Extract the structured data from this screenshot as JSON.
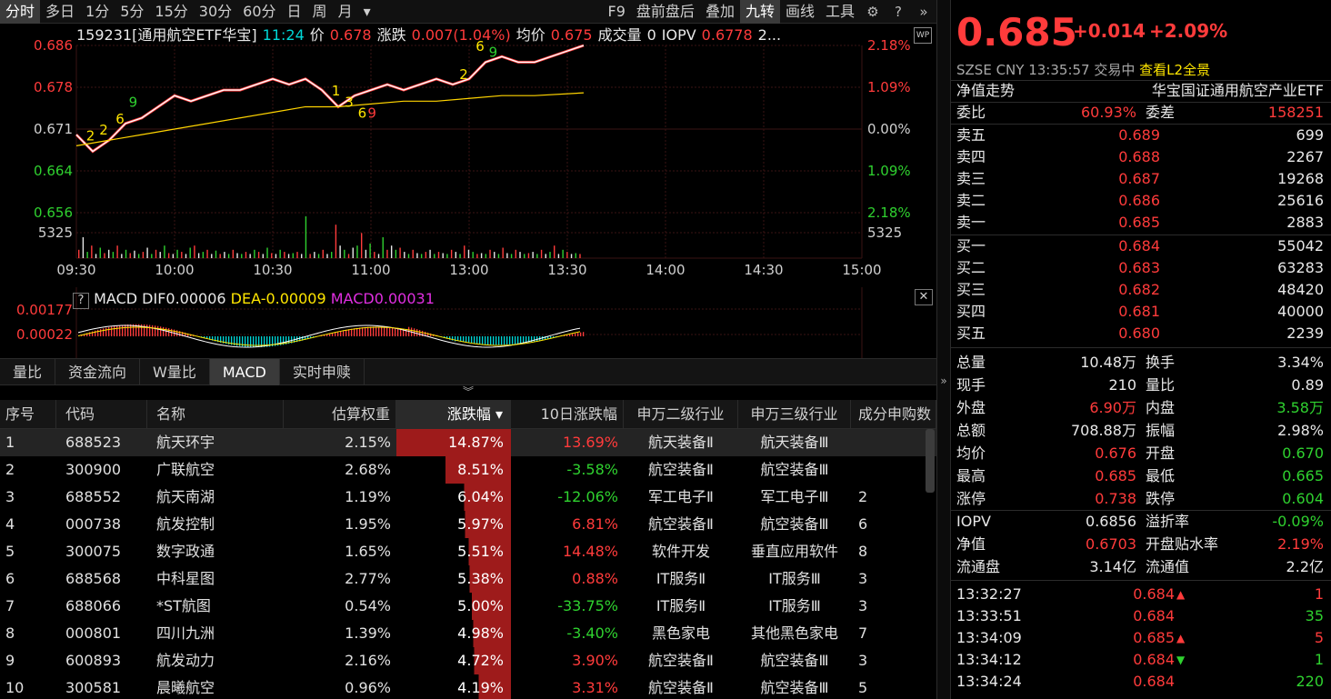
{
  "toolbar": {
    "tabs": [
      "分时",
      "多日",
      "1分",
      "5分",
      "15分",
      "30分",
      "60分",
      "日",
      "周",
      "月"
    ],
    "dropdown_glyph": "▾",
    "right_items": [
      "F9",
      "盘前盘后",
      "叠加",
      "九转",
      "画线",
      "工具"
    ],
    "active_tab": "分时",
    "active_right": "九转"
  },
  "info": {
    "code_name": "159231[通用航空ETF华宝]",
    "time": "11:24",
    "price_label": "价",
    "price": "0.678",
    "change_label": "涨跌",
    "change": "0.007(1.04%)",
    "avg_label": "均价",
    "avg": "0.675",
    "vol_label": "成交量",
    "vol": "0",
    "iopv_label": "IOPV",
    "iopv": "0.6778",
    "more": "2..."
  },
  "chart_data": {
    "type": "line",
    "y_left_ticks": [
      "0.686",
      "0.678",
      "0.671",
      "0.664",
      "0.656"
    ],
    "y_right_ticks": [
      "2.18%",
      "1.09%",
      "0.00%",
      "1.09%",
      "2.18%"
    ],
    "volume_label": "5325",
    "x_ticks": [
      "09:30",
      "10:00",
      "10:30",
      "11:00",
      "13:00",
      "13:30",
      "14:00",
      "14:30",
      "15:00"
    ],
    "ylim": [
      0.656,
      0.686
    ],
    "series": [
      {
        "name": "价",
        "color": "#ffffff",
        "x": [
          0,
          5,
          10,
          15,
          20,
          25,
          30,
          35,
          40,
          45,
          50,
          55,
          60,
          65,
          70,
          75,
          80,
          85,
          90,
          95,
          100,
          105,
          110,
          115,
          120,
          125,
          130,
          135,
          140,
          145,
          150,
          155
        ],
        "values": [
          0.67,
          0.667,
          0.669,
          0.672,
          0.673,
          0.675,
          0.677,
          0.676,
          0.677,
          0.678,
          0.678,
          0.679,
          0.68,
          0.679,
          0.68,
          0.678,
          0.675,
          0.677,
          0.678,
          0.679,
          0.678,
          0.679,
          0.68,
          0.679,
          0.68,
          0.683,
          0.684,
          0.683,
          0.683,
          0.684,
          0.685,
          0.686
        ]
      },
      {
        "name": "均价",
        "color": "#ffd400",
        "x": [
          0,
          10,
          20,
          30,
          40,
          50,
          60,
          70,
          80,
          90,
          100,
          110,
          120,
          130,
          140,
          155
        ],
        "values": [
          0.668,
          0.669,
          0.67,
          0.671,
          0.672,
          0.673,
          0.674,
          0.675,
          0.675,
          0.6755,
          0.676,
          0.676,
          0.6765,
          0.677,
          0.677,
          0.6775
        ]
      }
    ],
    "annotations": [
      {
        "x": 3,
        "y": 0.669,
        "text": "2",
        "color": "#ffe600"
      },
      {
        "x": 7,
        "y": 0.67,
        "text": "2",
        "color": "#ffe600"
      },
      {
        "x": 12,
        "y": 0.672,
        "text": "6",
        "color": "#ffe600"
      },
      {
        "x": 16,
        "y": 0.675,
        "text": "9",
        "color": "#2fd12f"
      },
      {
        "x": 78,
        "y": 0.677,
        "text": "1",
        "color": "#ffe600"
      },
      {
        "x": 82,
        "y": 0.675,
        "text": "3",
        "color": "#ffe600"
      },
      {
        "x": 86,
        "y": 0.673,
        "text": "6",
        "color": "#ffe600"
      },
      {
        "x": 89,
        "y": 0.673,
        "text": "9",
        "color": "#ff3b3b"
      },
      {
        "x": 117,
        "y": 0.68,
        "text": "2",
        "color": "#ffe600"
      },
      {
        "x": 122,
        "y": 0.685,
        "text": "6",
        "color": "#ffe600"
      },
      {
        "x": 126,
        "y": 0.684,
        "text": "9",
        "color": "#2fd12f"
      }
    ],
    "volume": [
      0.2,
      0.5,
      0.15,
      0.3,
      0.1,
      0.25,
      0.12,
      0.2,
      0.15,
      0.3,
      0.1,
      0.2,
      0.12,
      0.18,
      0.1,
      0.15,
      0.25,
      0.1,
      0.2,
      0.15,
      0.3,
      0.12,
      0.1,
      0.2,
      0.15,
      0.1,
      0.25,
      0.3,
      0.12,
      0.15,
      0.2,
      0.1,
      0.18,
      0.1,
      0.15,
      0.1,
      0.2,
      0.12,
      0.1,
      0.15,
      0.1,
      0.2,
      0.15,
      0.1,
      0.25,
      0.12,
      0.1,
      0.2,
      0.15,
      0.1,
      0.12,
      0.15,
      0.1,
      1.0,
      0.1,
      0.15,
      0.1,
      0.2,
      0.1,
      0.15,
      0.8,
      0.3,
      0.2,
      0.1,
      0.25,
      0.3,
      0.6,
      0.2,
      0.35,
      0.15,
      0.1,
      0.5,
      0.2,
      0.3,
      0.2,
      0.25,
      0.15,
      0.1,
      0.2,
      0.12,
      0.1,
      0.15,
      0.2,
      0.1,
      0.15,
      0.12,
      0.1,
      0.2,
      0.15,
      0.1,
      0.3,
      0.2,
      0.15,
      0.1,
      0.12,
      0.1,
      0.2,
      0.15,
      0.1,
      0.25,
      0.12,
      0.1,
      0.2,
      0.15,
      0.1,
      0.12,
      0.15,
      0.1,
      0.2,
      0.1,
      0.15,
      0.3,
      0.1,
      0.2,
      0.15,
      0.1,
      0.12,
      0.1
    ]
  },
  "macd": {
    "help": "?",
    "label": "MACD",
    "dif_label": "DIF",
    "dif": "0.00006",
    "dea_label": "DEA",
    "dea": "-0.00009",
    "macd_label": "MACD",
    "macd": "0.00031",
    "y_ticks": [
      "0.00177",
      "0.00022"
    ]
  },
  "lower_tabs": [
    "量比",
    "资金流向",
    "W量比",
    "MACD",
    "实时申赎"
  ],
  "lower_active": "MACD",
  "collapse_glyph": "︾",
  "table": {
    "headers": [
      "序号",
      "代码",
      "名称",
      "估算权重",
      "涨跌幅 ▾",
      "10日涨跌幅",
      "申万二级行业",
      "申万三级行业",
      "成分申购数"
    ],
    "rows": [
      [
        "1",
        "688523",
        "航天环宇",
        "2.15%",
        "14.87%",
        "13.69%",
        "航天装备Ⅱ",
        "航天装备Ⅲ",
        ""
      ],
      [
        "2",
        "300900",
        "广联航空",
        "2.68%",
        "8.51%",
        "-3.58%",
        "航空装备Ⅱ",
        "航空装备Ⅲ",
        ""
      ],
      [
        "3",
        "688552",
        "航天南湖",
        "1.19%",
        "6.04%",
        "-12.06%",
        "军工电子Ⅱ",
        "军工电子Ⅲ",
        "2"
      ],
      [
        "4",
        "000738",
        "航发控制",
        "1.95%",
        "5.97%",
        "6.81%",
        "航空装备Ⅱ",
        "航空装备Ⅲ",
        "6"
      ],
      [
        "5",
        "300075",
        "数字政通",
        "1.65%",
        "5.51%",
        "14.48%",
        "软件开发",
        "垂直应用软件",
        "8"
      ],
      [
        "6",
        "688568",
        "中科星图",
        "2.77%",
        "5.38%",
        "0.88%",
        "IT服务Ⅱ",
        "IT服务Ⅲ",
        "3"
      ],
      [
        "7",
        "688066",
        "*ST航图",
        "0.54%",
        "5.00%",
        "-33.75%",
        "IT服务Ⅱ",
        "IT服务Ⅲ",
        "3"
      ],
      [
        "8",
        "000801",
        "四川九洲",
        "1.39%",
        "4.98%",
        "-3.40%",
        "黑色家电",
        "其他黑色家电",
        "7"
      ],
      [
        "9",
        "600893",
        "航发动力",
        "2.16%",
        "4.72%",
        "3.90%",
        "航空装备Ⅱ",
        "航空装备Ⅲ",
        "3"
      ],
      [
        "10",
        "300581",
        "晨曦航空",
        "0.96%",
        "4.19%",
        "3.31%",
        "航空装备Ⅱ",
        "航空装备Ⅲ",
        "5"
      ]
    ],
    "bar_fractions": [
      1.0,
      0.57,
      0.41,
      0.4,
      0.37,
      0.36,
      0.34,
      0.33,
      0.32,
      0.28
    ]
  },
  "panel": {
    "price": "0.685",
    "change": "+0.014",
    "pct": "+2.09%",
    "exchange": "SZSE",
    "currency": "CNY",
    "time": "13:35:57",
    "status": "交易中",
    "l2_link": "查看L2全景",
    "nav_title": "净值走势",
    "fund_name": "华宝国证通用航空产业ETF",
    "weibi_label": "委比",
    "weibi": "60.93%",
    "weicha_label": "委差",
    "weicha": "158251",
    "asks": [
      {
        "label": "卖五",
        "price": "0.689",
        "vol": "699"
      },
      {
        "label": "卖四",
        "price": "0.688",
        "vol": "2267"
      },
      {
        "label": "卖三",
        "price": "0.687",
        "vol": "19268"
      },
      {
        "label": "卖二",
        "price": "0.686",
        "vol": "25616"
      },
      {
        "label": "卖一",
        "price": "0.685",
        "vol": "2883"
      }
    ],
    "bids": [
      {
        "label": "买一",
        "price": "0.684",
        "vol": "55042"
      },
      {
        "label": "买二",
        "price": "0.683",
        "vol": "63283"
      },
      {
        "label": "买三",
        "price": "0.682",
        "vol": "48420"
      },
      {
        "label": "买四",
        "price": "0.681",
        "vol": "40000"
      },
      {
        "label": "买五",
        "price": "0.680",
        "vol": "2239"
      }
    ],
    "stats": [
      [
        {
          "l": "总量",
          "v": "10.48万",
          "c": "white"
        },
        {
          "l": "换手",
          "v": "3.34%",
          "c": "white"
        }
      ],
      [
        {
          "l": "现手",
          "v": "210",
          "c": "white"
        },
        {
          "l": "量比",
          "v": "0.89",
          "c": "white"
        }
      ],
      [
        {
          "l": "外盘",
          "v": "6.90万",
          "c": "red"
        },
        {
          "l": "内盘",
          "v": "3.58万",
          "c": "green"
        }
      ],
      [
        {
          "l": "总额",
          "v": "708.88万",
          "c": "white"
        },
        {
          "l": "振幅",
          "v": "2.98%",
          "c": "white"
        }
      ],
      [
        {
          "l": "均价",
          "v": "0.676",
          "c": "red"
        },
        {
          "l": "开盘",
          "v": "0.670",
          "c": "green"
        }
      ],
      [
        {
          "l": "最高",
          "v": "0.685",
          "c": "red"
        },
        {
          "l": "最低",
          "v": "0.665",
          "c": "green"
        }
      ],
      [
        {
          "l": "涨停",
          "v": "0.738",
          "c": "red"
        },
        {
          "l": "跌停",
          "v": "0.604",
          "c": "green"
        }
      ]
    ],
    "stats2": [
      [
        {
          "l": "IOPV",
          "v": "0.6856",
          "c": "white"
        },
        {
          "l": "溢折率",
          "v": "-0.09%",
          "c": "green"
        }
      ],
      [
        {
          "l": "净值",
          "v": "0.6703",
          "c": "red"
        },
        {
          "l": "开盘贴水率",
          "v": "2.19%",
          "c": "red"
        }
      ],
      [
        {
          "l": "流通盘",
          "v": "3.14亿",
          "c": "white"
        },
        {
          "l": "流通值",
          "v": "2.2亿",
          "c": "white"
        }
      ]
    ],
    "ticks": [
      {
        "t": "13:32:27",
        "p": "0.684",
        "dir": "up",
        "v": "1",
        "vc": "red"
      },
      {
        "t": "13:33:51",
        "p": "0.684",
        "dir": "",
        "v": "35",
        "vc": "green"
      },
      {
        "t": "13:34:09",
        "p": "0.685",
        "dir": "up",
        "v": "5",
        "vc": "red"
      },
      {
        "t": "13:34:12",
        "p": "0.684",
        "dir": "down",
        "v": "1",
        "vc": "green"
      },
      {
        "t": "13:34:24",
        "p": "0.684",
        "dir": "",
        "v": "220",
        "vc": "green"
      }
    ]
  },
  "colors": {
    "up": "#ff3b3b",
    "down": "#2fd12f",
    "avg": "#ffd400",
    "grid": "#3a1010"
  }
}
